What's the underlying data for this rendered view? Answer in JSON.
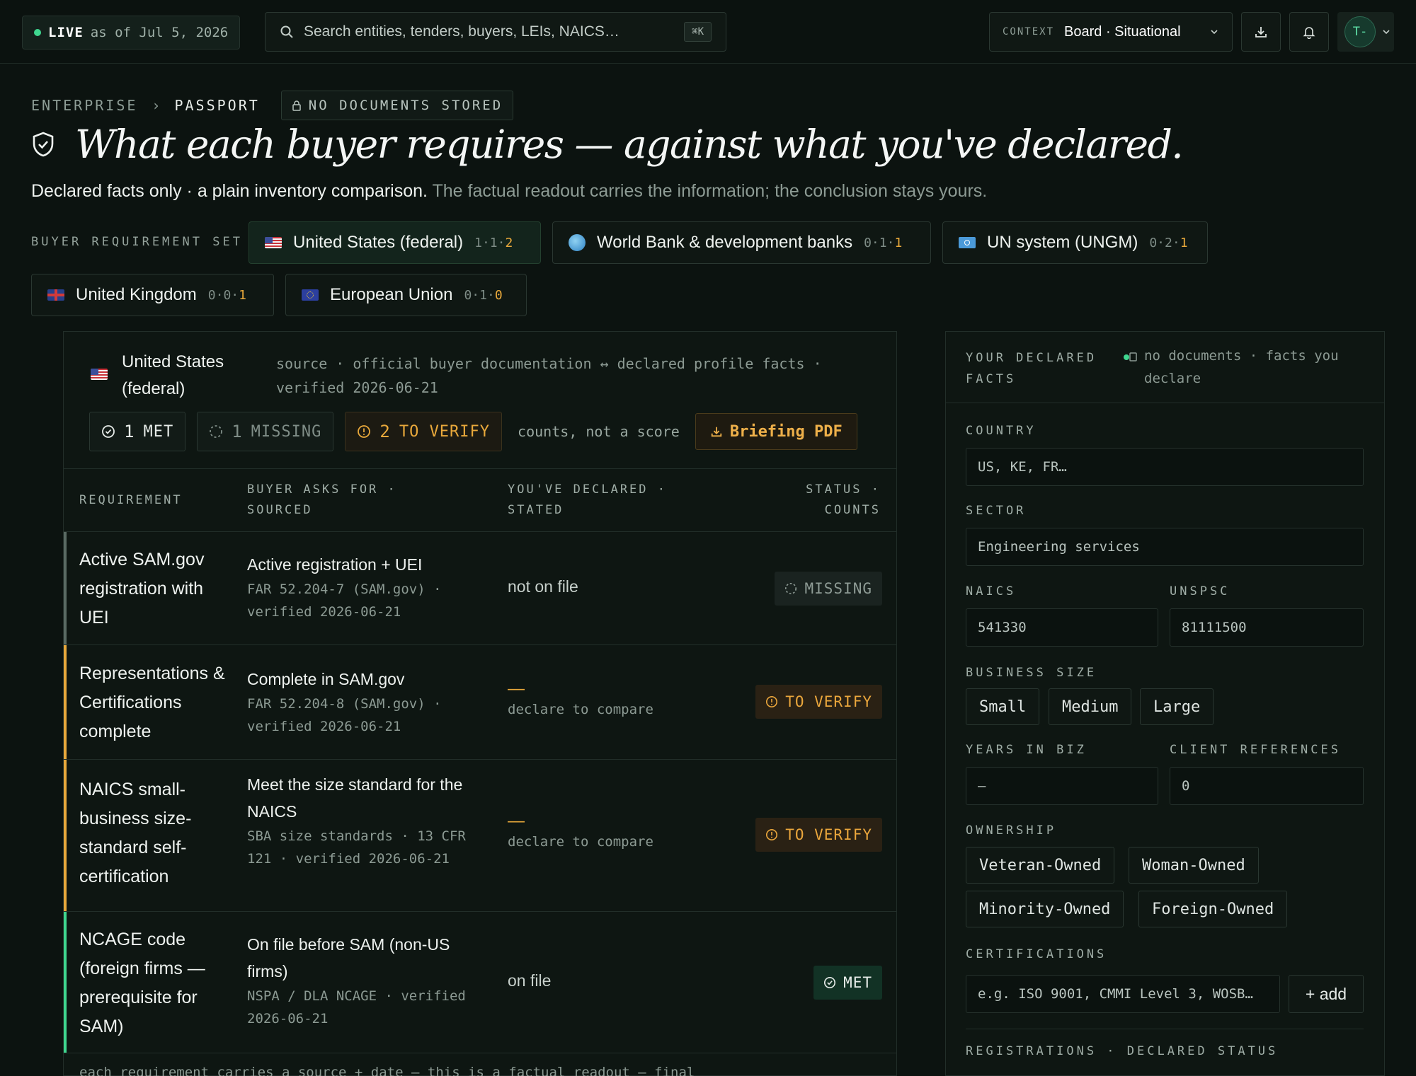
{
  "topbar": {
    "live_label": "LIVE",
    "live_date": "as of Jul 5, 2026",
    "search_placeholder": "Search entities, tenders, buyers, LEIs, NAICS…",
    "search_shortcut": "⌘K",
    "context_key": "CONTEXT",
    "context_value": "Board · Situational",
    "avatar_initials": "T-"
  },
  "breadcrumb": {
    "level1": "ENTERPRISE",
    "separator": "›",
    "level2": "PASSPORT",
    "badge": "NO DOCUMENTS STORED"
  },
  "page": {
    "title": "What each buyer requires — against what you've declared.",
    "subtitle_strong": "Declared facts only · a plain inventory comparison.",
    "subtitle_rest": " The factual readout carries the information; the conclusion stays yours."
  },
  "requirement_sets": {
    "label": "BUYER REQUIREMENT SET",
    "items": [
      {
        "name": "United States (federal)",
        "count_prefix": "1·1·",
        "count_hi": "2",
        "flag": "us-flag",
        "active": true
      },
      {
        "name": "World Bank & development banks",
        "count_prefix": "0·1·",
        "count_hi": "1",
        "flag": "globe-flag",
        "active": false
      },
      {
        "name": "UN system (UNGM)",
        "count_prefix": "0·2·",
        "count_hi": "1",
        "flag": "un-flag",
        "active": false
      },
      {
        "name": "United Kingdom",
        "count_prefix": "0·0·",
        "count_hi": "1",
        "flag": "uk-flag",
        "active": false
      },
      {
        "name": "European Union",
        "count_prefix": "0·1·",
        "count_hi": "0",
        "flag": "eu-flag",
        "active": false
      }
    ]
  },
  "detail": {
    "country": "United States (federal)",
    "source_note": "source · official buyer documentation ↔ declared profile facts · verified 2026-06-21",
    "met_count": "1",
    "met_label": "MET",
    "missing_count": "1",
    "missing_label": "MISSING",
    "verify_count": "2",
    "verify_label": "TO VERIFY",
    "counts_note": "counts, not a score",
    "briefing_label": "Briefing PDF",
    "columns": {
      "requirement": "REQUIREMENT",
      "buyer_asks": "BUYER ASKS FOR · SOURCED",
      "declared": "YOU'VE DECLARED · STATED",
      "status": "STATUS · COUNTS"
    },
    "rows": [
      {
        "requirement": "Active SAM.gov registration with UEI",
        "ask": "Active registration + UEI",
        "source": "FAR 52.204-7 (SAM.gov) · verified 2026-06-21",
        "declared": "not on file",
        "declared_hint": "",
        "status": "MISSING",
        "status_kind": "missing",
        "accent": "#5a6a63"
      },
      {
        "requirement": "Representations & Certifications complete",
        "ask": "Complete in SAM.gov",
        "source": "FAR 52.204-8 (SAM.gov) · verified 2026-06-21",
        "declared": "—",
        "declared_hint": "declare to compare",
        "status": "TO VERIFY",
        "status_kind": "verify",
        "accent": "#e8a83b"
      },
      {
        "requirement": "NAICS small-business size-standard self-certification",
        "ask": "Meet the size standard for the NAICS",
        "source": "SBA size standards · 13 CFR 121 · verified 2026-06-21",
        "declared": "—",
        "declared_hint": "declare to compare",
        "status": "TO VERIFY",
        "status_kind": "verify",
        "accent": "#e8a83b"
      },
      {
        "requirement": "NCAGE code (foreign firms — prerequisite for SAM)",
        "ask": "On file before SAM (non-US firms)",
        "source": "NSPA / DLA NCAGE · verified 2026-06-21",
        "declared": "on file",
        "declared_hint": "",
        "status": "MET",
        "status_kind": "met",
        "accent": "#3fd68f"
      }
    ],
    "footer_note": "each requirement carries a source + date — this is a factual readout — final"
  },
  "declared": {
    "title": "YOUR DECLARED FACTS",
    "note": "no documents · facts you declare",
    "country_label": "COUNTRY",
    "country_placeholder": "US, KE, FR…",
    "sector_label": "SECTOR",
    "sector_value": "Engineering services",
    "naics_label": "NAICS",
    "naics_value": "541330",
    "unspsc_label": "UNSPSC",
    "unspsc_value": "81111500",
    "size_label": "BUSINESS SIZE",
    "sizes": [
      "Small",
      "Medium",
      "Large"
    ],
    "years_label": "YEARS IN BIZ",
    "years_value": "–",
    "refs_label": "CLIENT REFERENCES",
    "refs_value": "0",
    "ownership_label": "OWNERSHIP",
    "ownership": [
      "Veteran-Owned",
      "Woman-Owned",
      "Minority-Owned",
      "Foreign-Owned"
    ],
    "cert_label": "CERTIFICATIONS",
    "cert_placeholder": "e.g. ISO 9001, CMMI Level 3, WOSB…",
    "add_label": "+ add",
    "registrations_label": "REGISTRATIONS · DECLARED STATUS"
  }
}
